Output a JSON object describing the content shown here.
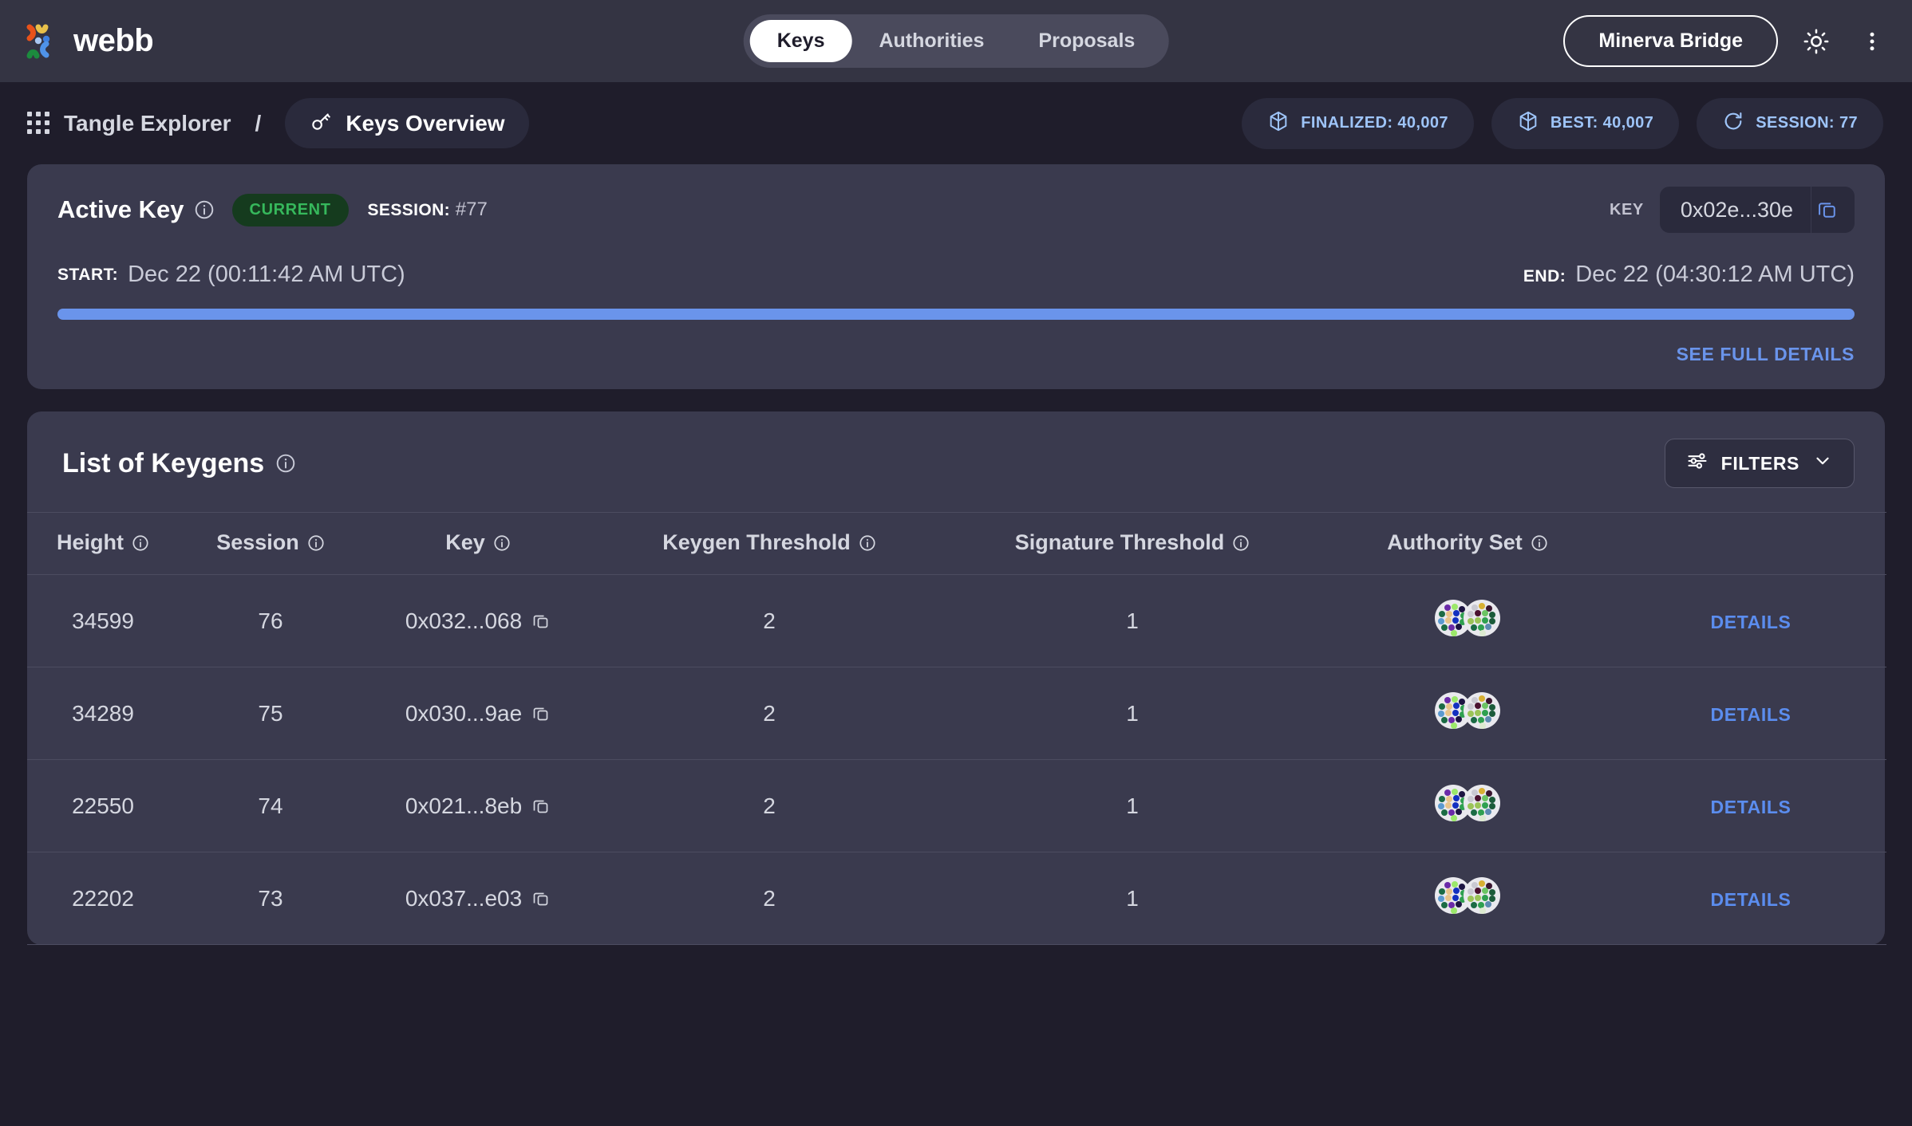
{
  "header": {
    "brand": "webb",
    "tabs": [
      {
        "label": "Keys",
        "active": true
      },
      {
        "label": "Authorities",
        "active": false
      },
      {
        "label": "Proposals",
        "active": false
      }
    ],
    "bridge_button": "Minerva Bridge",
    "theme_icon": "sun-icon",
    "menu_icon": "more-vertical-icon"
  },
  "breadcrumb": {
    "grid_icon": "grid-icon",
    "root": "Tangle Explorer",
    "separator": "/",
    "current_icon": "key-icon",
    "current": "Keys Overview"
  },
  "chips": [
    {
      "icon": "cube-icon",
      "label": "FINALIZED: 40,007"
    },
    {
      "icon": "cube-icon",
      "label": "BEST: 40,007"
    },
    {
      "icon": "refresh-icon",
      "label": "SESSION: 77"
    }
  ],
  "active_key": {
    "title": "Active Key",
    "info_icon": "info-icon",
    "badge": "CURRENT",
    "session_label": "SESSION:",
    "session_value": "#77",
    "key_label": "KEY",
    "key_value": "0x02e...30e",
    "copy_icon": "copy-icon",
    "start_label": "START:",
    "start_value": "Dec 22 (00:11:42 AM UTC)",
    "end_label": "END:",
    "end_value": "Dec 22 (04:30:12 AM UTC)",
    "progress_percent": 100,
    "see_full_details": "SEE FULL DETAILS"
  },
  "keygens": {
    "title": "List of Keygens",
    "info_icon": "info-icon",
    "filters_label": "FILTERS",
    "filters_icon": "sliders-icon",
    "chevron_icon": "chevron-down-icon",
    "columns": [
      "Height",
      "Session",
      "Key",
      "Keygen Threshold",
      "Signature Threshold",
      "Authority Set",
      ""
    ],
    "rows": [
      {
        "height": "34599",
        "session": "76",
        "key": "0x032...068",
        "keygen_threshold": "2",
        "signature_threshold": "1",
        "authority_set": "2 authorities",
        "details": "DETAILS"
      },
      {
        "height": "34289",
        "session": "75",
        "key": "0x030...9ae",
        "keygen_threshold": "2",
        "signature_threshold": "1",
        "authority_set": "2 authorities",
        "details": "DETAILS"
      },
      {
        "height": "22550",
        "session": "74",
        "key": "0x021...8eb",
        "keygen_threshold": "2",
        "signature_threshold": "1",
        "authority_set": "2 authorities",
        "details": "DETAILS"
      },
      {
        "height": "22202",
        "session": "73",
        "key": "0x037...e03",
        "keygen_threshold": "2",
        "signature_threshold": "1",
        "authority_set": "2 authorities",
        "details": "DETAILS"
      }
    ]
  },
  "colors": {
    "page_bg": "#1F1D2B",
    "topbar_bg": "#343443",
    "card_bg": "#3A3A4E",
    "accent_blue": "#6A94EB",
    "chip_text": "#9EC4F8",
    "badge_green_text": "#36B85C",
    "badge_green_bg": "#153B1E"
  }
}
